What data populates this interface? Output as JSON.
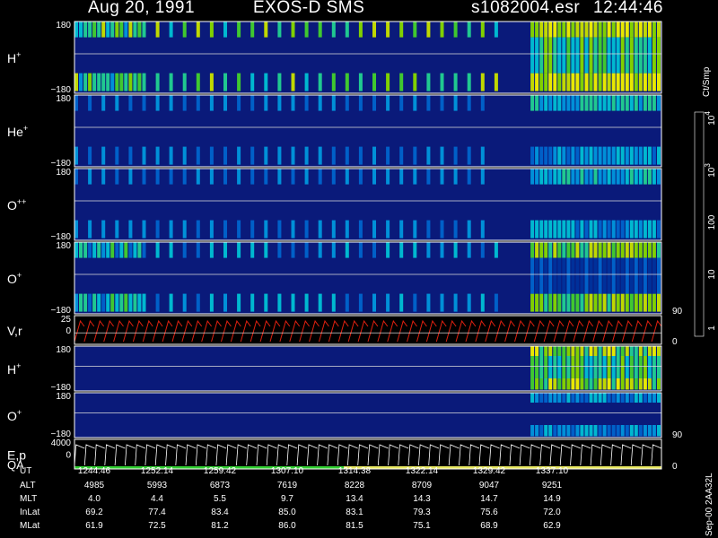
{
  "header": {
    "date": "Aug 20, 1991",
    "instrument": "EXOS-D SMS",
    "file": "s1082004.esr",
    "time": "12:44:46"
  },
  "colorbar": {
    "unit": "Ct/Smp",
    "tick_labels": [
      "1",
      "10",
      "100",
      "10",
      "10"
    ],
    "tick_sup": [
      "",
      "",
      "",
      "3",
      "4"
    ],
    "colors": [
      "#0a0a8a",
      "#0a2ab0",
      "#0a6ad8",
      "#00a8d8",
      "#00c8c0",
      "#20d070",
      "#48d020",
      "#a0d000",
      "#e8e800",
      "#c8a000",
      "#8a7800",
      "#584800",
      "#c81010",
      "#e81010",
      "#880000",
      "#581010",
      "#ffffff"
    ]
  },
  "chart_data": {
    "type": "heatmap",
    "panels": [
      {
        "id": "h-plus",
        "label": "H",
        "sup": "+",
        "y_top": "180",
        "y_bottom": "−180",
        "kind": "spectrogram",
        "band": "stripes_then_dense"
      },
      {
        "id": "he-plus",
        "label": "He",
        "sup": "+",
        "y_top": "180",
        "y_bottom": "−180",
        "kind": "spectrogram",
        "band": "weak"
      },
      {
        "id": "o-plusplus",
        "label": "O",
        "sup": "++",
        "y_top": "180",
        "y_bottom": "−180",
        "kind": "spectrogram",
        "band": "weak"
      },
      {
        "id": "o-plus",
        "label": "O",
        "sup": "+",
        "y_top": "180",
        "y_bottom": "−180",
        "right_tick": "90",
        "kind": "spectrogram",
        "band": "medium"
      },
      {
        "id": "vr",
        "label": "V,r",
        "y_top": "25",
        "y_mid": "0",
        "right_tick": "0",
        "kind": "line"
      },
      {
        "id": "h-plus-2",
        "label": "H",
        "sup": "+",
        "y_top": "180",
        "y_bottom": "−180",
        "kind": "spectrogram",
        "band": "late_dense"
      },
      {
        "id": "o-plus-2",
        "label": "O",
        "sup": "+",
        "y_top": "180",
        "y_bottom": "−180",
        "right_tick": "90",
        "kind": "spectrogram",
        "band": "late_weak"
      },
      {
        "id": "ep-qa",
        "label": "E,p",
        "label2": "QA",
        "y_top": "4000",
        "y_mid": "0",
        "right_tick": "0",
        "kind": "energy"
      }
    ],
    "ut": [
      "1244:46",
      "1252:14",
      "1259:42",
      "1307:10",
      "1314:38",
      "1322:14",
      "1329:42",
      "1337:10"
    ],
    "alt": [
      "4985",
      "5993",
      "6873",
      "7619",
      "8228",
      "8709",
      "9047",
      "9251"
    ],
    "mlt": [
      "4.0",
      "4.4",
      "5.5",
      "9.7",
      "13.4",
      "14.3",
      "14.7",
      "14.9"
    ],
    "inlat": [
      "69.2",
      "77.4",
      "83.4",
      "85.0",
      "83.1",
      "79.3",
      "75.6",
      "72.0"
    ],
    "mlat": [
      "61.9",
      "72.5",
      "81.2",
      "86.0",
      "81.5",
      "75.1",
      "68.9",
      "62.9"
    ]
  },
  "table": {
    "row_labels": [
      "UT",
      "ALT",
      "MLT",
      "InLat",
      "MLat"
    ]
  },
  "footer": {
    "stamp": "Sep-00  2AA32L"
  }
}
